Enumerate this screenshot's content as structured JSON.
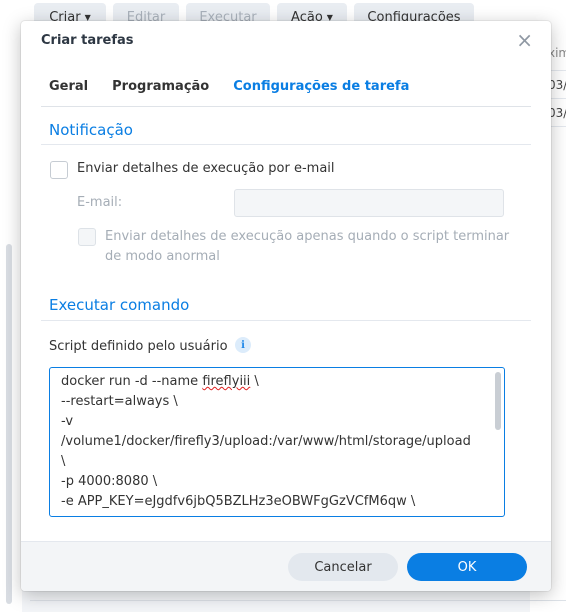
{
  "toolbar": {
    "create": "Criar",
    "edit": "Editar",
    "run": "Executar",
    "action": "Ação",
    "settings": "Configurações"
  },
  "background_table": {
    "header": "xim",
    "row1": "03/",
    "row2": "03/"
  },
  "dialog": {
    "title": "Criar tarefas",
    "close": "×",
    "tabs": [
      "Geral",
      "Programação",
      "Configurações de tarefa"
    ],
    "active_tab": "Configurações de tarefa",
    "notification": {
      "title": "Notificação",
      "send_details_label": "Enviar detalhes de execução por e-mail",
      "email_label": "E-mail:",
      "email_value": "",
      "abnormal_label_line1": "Enviar detalhes de execução apenas quando o script terminar",
      "abnormal_label_line2": "de modo anormal"
    },
    "run_command": {
      "title": "Executar comando",
      "script_label": "Script definido pelo usuário",
      "info_icon": "i",
      "script_lines": [
        "docker run -d --name ",
        "--restart=always \\",
        "-v",
        "/volume1/docker/firefly3/upload:/var/www/html/storage/upload",
        "\\",
        "-p 4000:8080 \\",
        "-e APP_KEY=eJgdfv6jbQ5BZLHz3eOBWFgGzVCfM6qw \\"
      ],
      "script_first_word": "fireflyiii",
      "script_first_suffix": " \\"
    },
    "buttons": {
      "cancel": "Cancelar",
      "ok": "OK"
    }
  },
  "colors": {
    "accent": "#0a7ee3",
    "disabled_text": "#a5adb6"
  }
}
